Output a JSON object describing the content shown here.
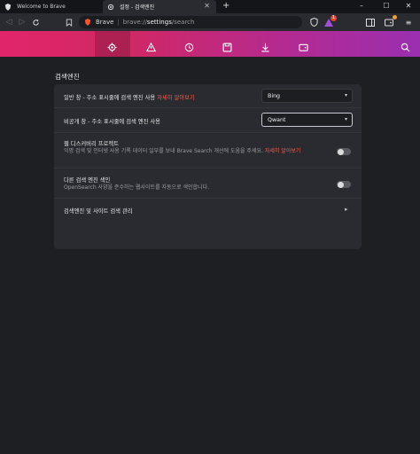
{
  "tabs": [
    {
      "title": "Welcome to Brave"
    },
    {
      "title": "설정 - 검색엔진"
    }
  ],
  "new_tab_label": "+",
  "window_controls": {
    "minimize": "–",
    "maximize": "☐",
    "close": "✕"
  },
  "address_bar": {
    "brand": "Brave",
    "url_prefix": "brave://",
    "url_path": "settings",
    "url_suffix": "/search"
  },
  "toolbar_badges": {
    "shields_count": "1"
  },
  "settings": {
    "section_title": "검색엔진",
    "rows": [
      {
        "label": "일반 창 - 주소 표시줄에 검색 엔진 사용",
        "link": "자세히 알아보기",
        "select_value": "Bing"
      },
      {
        "label": "비공개 창 - 주소 표시줄에 검색 엔진 사용",
        "select_value": "Qwant"
      },
      {
        "label": "웹 디스커버리 프로젝트",
        "desc": "익명 검색 및 인터넷 사용 기록 데이터 일부를 보내 Brave Search 개선에 도움을 주세요.",
        "link": "자세히 알아보기"
      },
      {
        "label": "다른 검색 엔진 색인",
        "desc": "OpenSearch 사양을 준수하는 웹사이트를 자동으로 색인합니다."
      },
      {
        "label": "검색엔진 및 사이트 검색 관리"
      }
    ]
  },
  "colors": {
    "accent_link": "#ff5a45",
    "gradient_start": "#e1256a",
    "gradient_end": "#9a2fb0",
    "background": "#1e1f23",
    "card": "#2a2b31"
  },
  "icons": [
    "brave-lion-icon",
    "gear-icon",
    "close-icon",
    "back-icon",
    "forward-icon",
    "reload-icon",
    "bookmark-icon",
    "shield-icon",
    "rewards-icon",
    "wallet-icon",
    "menu-icon",
    "warning-icon",
    "history-icon",
    "save-icon",
    "download-icon",
    "search-icon"
  ]
}
